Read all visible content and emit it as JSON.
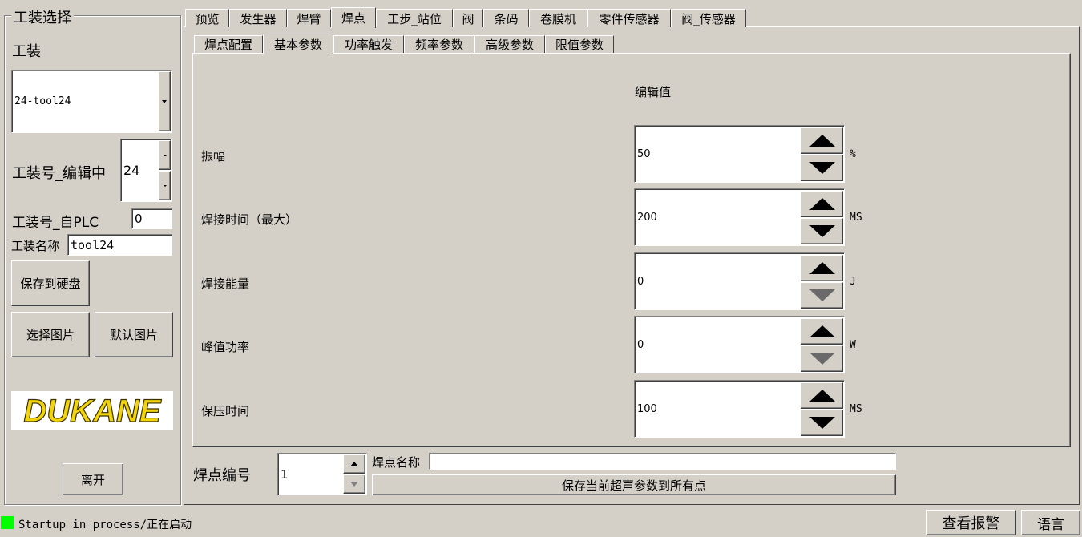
{
  "left_panel": {
    "group_title": "工装选择",
    "tooling_label": "工装",
    "tooling_selected": "24-tool24",
    "tooling_no_editing_label": "工装号_编辑中",
    "tooling_no_editing_value": "24",
    "tooling_no_plc_label": "工装号_自PLC",
    "tooling_no_plc_value": "0",
    "tooling_name_label": "工装名称",
    "tooling_name_value": "tool24",
    "save_to_disk": "保存到硬盘",
    "select_image": "选择图片",
    "default_image": "默认图片",
    "logo_text": "DUKANE",
    "exit": "离开"
  },
  "main_tabs": [
    {
      "label": "预览",
      "active": false
    },
    {
      "label": "发生器",
      "active": false
    },
    {
      "label": "焊臂",
      "active": false
    },
    {
      "label": "焊点",
      "active": true
    },
    {
      "label": "工步_站位",
      "active": false
    },
    {
      "label": "阀",
      "active": false
    },
    {
      "label": "条码",
      "active": false
    },
    {
      "label": "卷膜机",
      "active": false
    },
    {
      "label": "零件传感器",
      "active": false
    },
    {
      "label": "阀_传感器",
      "active": false
    }
  ],
  "sub_tabs": [
    {
      "label": "焊点配置",
      "active": false
    },
    {
      "label": "基本参数",
      "active": true
    },
    {
      "label": "功率触发",
      "active": false
    },
    {
      "label": "频率参数",
      "active": false
    },
    {
      "label": "高级参数",
      "active": false
    },
    {
      "label": "限值参数",
      "active": false
    }
  ],
  "params": {
    "column_header": "编辑值",
    "rows": [
      {
        "label": "振幅",
        "value": "50",
        "unit": "%",
        "down_enabled": true
      },
      {
        "label": "焊接时间（最大）",
        "value": "200",
        "unit": "MS",
        "down_enabled": true
      },
      {
        "label": "焊接能量",
        "value": "0",
        "unit": "J",
        "down_enabled": false
      },
      {
        "label": "峰值功率",
        "value": "0",
        "unit": "W",
        "down_enabled": false
      },
      {
        "label": "保压时间",
        "value": "100",
        "unit": "MS",
        "down_enabled": true
      }
    ]
  },
  "weld_point": {
    "number_label": "焊点编号",
    "number_value": "1",
    "name_label": "焊点名称",
    "name_value": "",
    "save_all_button": "保存当前超声参数到所有点"
  },
  "status_bar": {
    "status_text": "Startup in process/正在启动",
    "indicator_color": "#00ff00",
    "view_alarms": "查看报警",
    "language": "语言"
  }
}
